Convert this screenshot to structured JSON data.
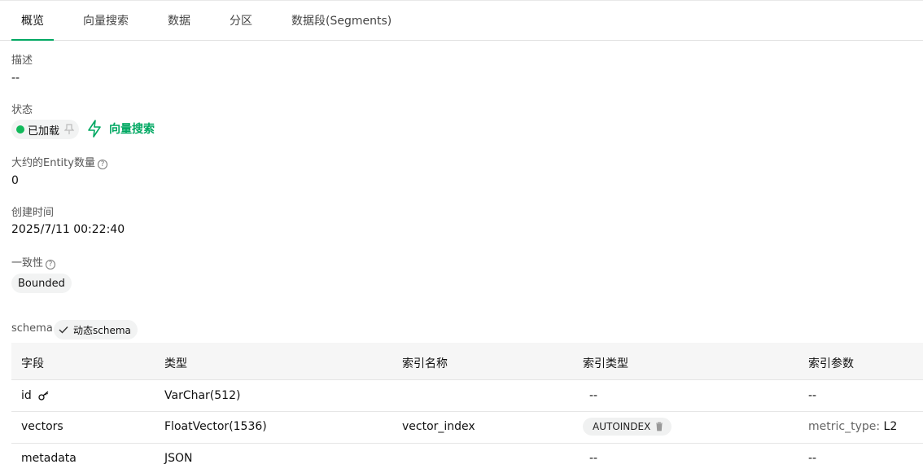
{
  "tabs": [
    {
      "label": "概览"
    },
    {
      "label": "向量搜索"
    },
    {
      "label": "数据"
    },
    {
      "label": "分区"
    },
    {
      "label": "数据段(Segments)"
    }
  ],
  "overview": {
    "description_label": "描述",
    "description_value": "--",
    "status_label": "状态",
    "status_value": "已加载",
    "vector_search_link": "向量搜索",
    "entity_label": "大约的Entity数量",
    "entity_value": "0",
    "created_label": "创建时间",
    "created_value": "2025/7/11 00:22:40",
    "consistency_label": "一致性",
    "consistency_value": "Bounded",
    "help_glyph": "?"
  },
  "schema": {
    "label": "schema",
    "dynamic_badge": "动态schema",
    "columns": [
      "字段",
      "类型",
      "索引名称",
      "索引类型",
      "索引参数"
    ],
    "rows": [
      {
        "field": "id",
        "type": "VarChar(512)",
        "index_name": "",
        "index_type": "--",
        "index_params_key": "",
        "index_params_value": "--"
      },
      {
        "field": "vectors",
        "type": "FloatVector(1536)",
        "index_name": "vector_index",
        "index_type": "AUTOINDEX",
        "index_params_key": "metric_type:",
        "index_params_value": "L2"
      },
      {
        "field": "metadata",
        "type": "JSON",
        "index_name": "",
        "index_type": "--",
        "index_params_key": "",
        "index_params_value": "--"
      }
    ]
  },
  "colors": {
    "accent": "#00a862",
    "status_green": "#11b95a"
  },
  "icons": [
    "release-icon",
    "lightning-icon",
    "help-circle-icon",
    "check-icon",
    "primary-key-icon",
    "delete-icon"
  ]
}
